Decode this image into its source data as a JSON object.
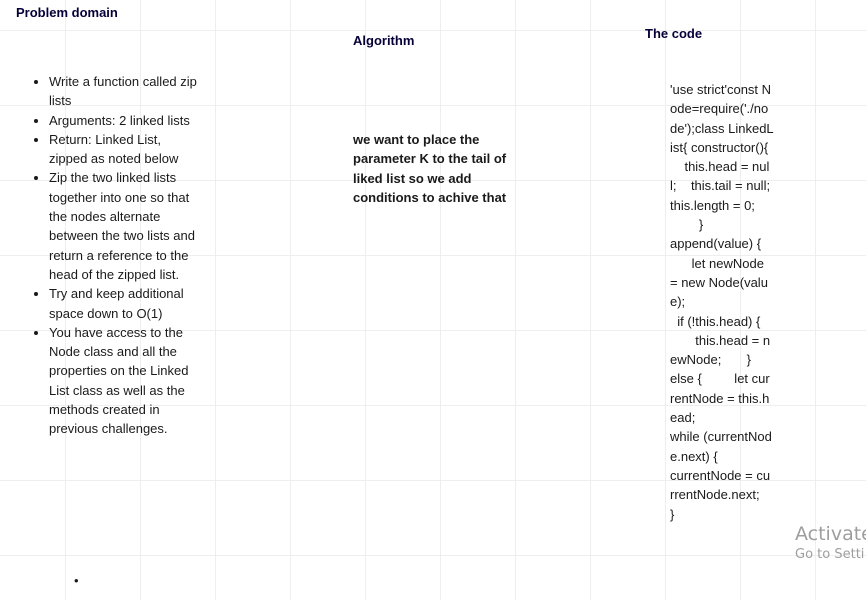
{
  "problem_domain": {
    "heading": "Problem domain",
    "items": [
      "Write a function called zip lists",
      "Arguments: 2 linked lists",
      "Return: Linked List, zipped as noted below",
      "Zip the two linked lists together into one so that the nodes alternate between the two lists and return a reference to the head of the zipped list.",
      "Try and keep additional space down to O(1)",
      "You have access to the Node class and all the properties on the Linked List class as well as the methods created in previous challenges."
    ],
    "trailing_bullet": "•"
  },
  "algorithm": {
    "heading": "Algorithm",
    "text": " we want to place the parameter K to the tail of liked list so we add conditions to achive that"
  },
  "code": {
    "heading": "The code",
    "text": "'use strict'const Node=require('./node');class LinkedList{ constructor(){\n    this.head = null;    this.tail = null;\nthis.length = 0;\n        }\nappend(value) {\n      let newNode = new Node(value);\n  if (!this.head) {\n       this.head = newNode;       }\nelse {         let currentNode = this.head;\nwhile (currentNode.next) {\ncurrentNode = currentNode.next;        }"
  },
  "watermark": {
    "title": "Activate",
    "subtitle": "Go to Setti"
  }
}
